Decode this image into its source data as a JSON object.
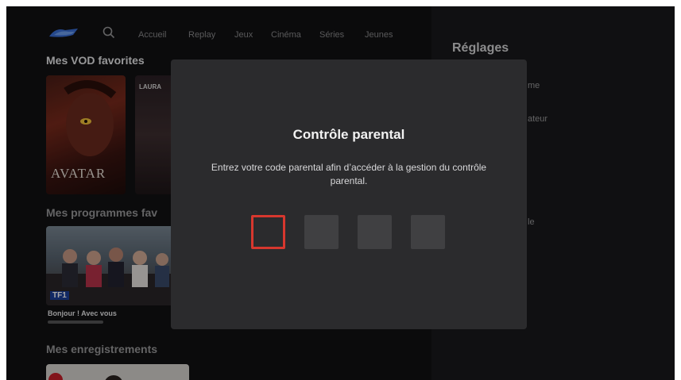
{
  "nav": {
    "items": [
      "Accueil",
      "Replay",
      "Jeux",
      "Cinéma",
      "Séries",
      "Jeunes"
    ]
  },
  "sections": {
    "vod_title": "Mes VOD favorites",
    "programs_title": "Mes programmes fav",
    "recordings_title": "Mes enregistrements"
  },
  "vod": {
    "avatar_title": "AVATAR",
    "poster2_caption": "LAURA"
  },
  "program": {
    "channel": "TF1",
    "title": "Bonjour ! Avec vous"
  },
  "settings": {
    "title": "Réglages",
    "item_partial_1": "me",
    "item_partial_2": "ateur",
    "item_partial_3": "le"
  },
  "dialog": {
    "title": "Contrôle parental",
    "message": "Entrez votre code parental afin d’accéder à la gestion du contrôle parental.",
    "pin_length": 4,
    "active_index": 0
  },
  "colors": {
    "background": "#111113",
    "dialog": "#2b2b2d",
    "pin_box": "#404042",
    "focus": "#d7372e"
  }
}
